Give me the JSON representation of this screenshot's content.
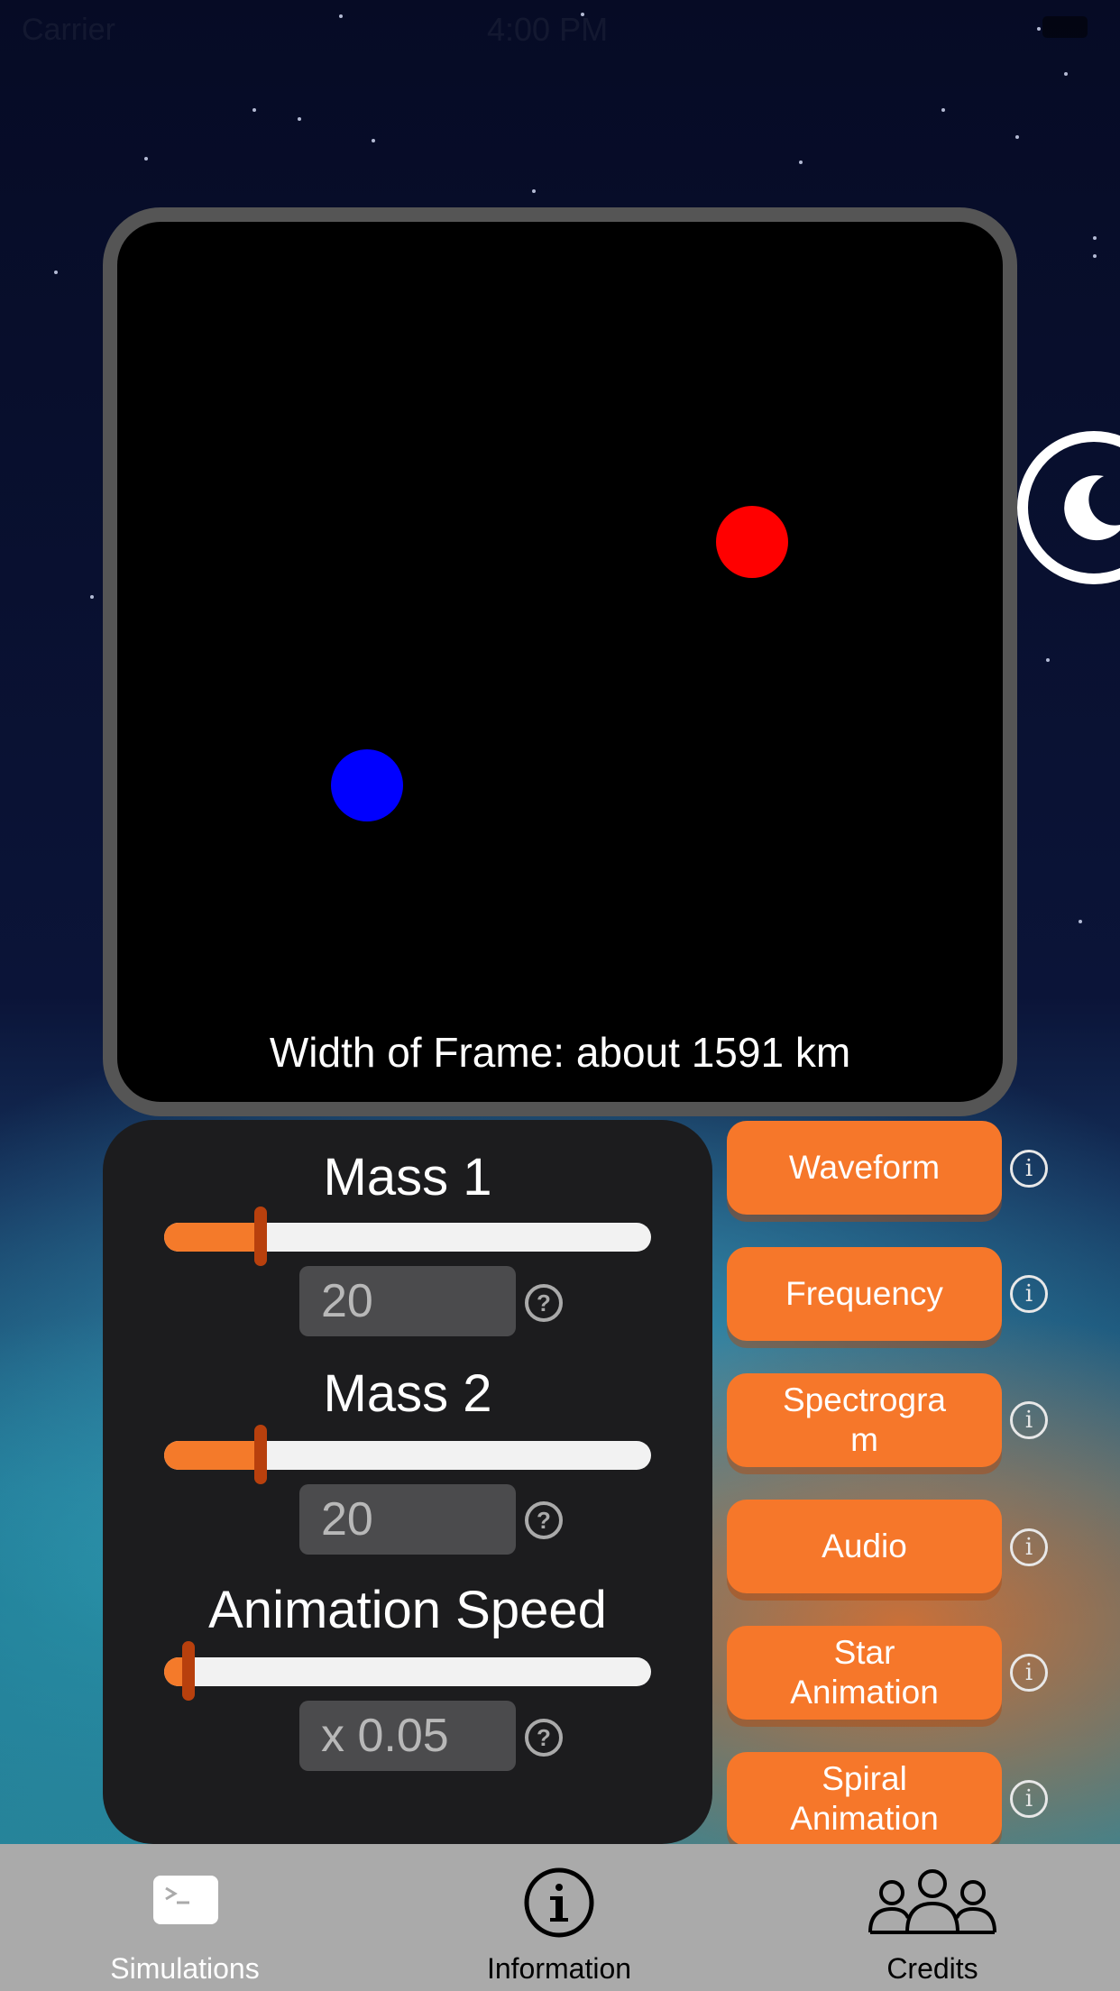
{
  "status_bar": {
    "carrier": "Carrier",
    "time": "4:00 PM"
  },
  "simulation": {
    "frame_caption": "Width of Frame: about 1591 km",
    "body1_color": "#ff0000",
    "body2_color": "#0000ff"
  },
  "controls": {
    "mass1": {
      "label": "Mass 1",
      "value": "20",
      "slider_fraction": 0.2
    },
    "mass2": {
      "label": "Mass 2",
      "value": "20",
      "slider_fraction": 0.2
    },
    "speed": {
      "label": "Animation Speed",
      "value": "x 0.05",
      "slider_fraction": 0.05
    },
    "help_glyph": "?"
  },
  "actions": [
    {
      "label": "Waveform"
    },
    {
      "label": "Frequency"
    },
    {
      "label": "Spectrogra\nm"
    },
    {
      "label": "Audio"
    },
    {
      "label": "Star\nAnimation"
    },
    {
      "label": "Spiral\nAnimation"
    }
  ],
  "info_glyph": "i",
  "tabbar": {
    "tabs": [
      {
        "label": "Simulations",
        "icon": "terminal-icon",
        "selected": true
      },
      {
        "label": "Information",
        "icon": "info-circle-icon",
        "selected": false
      },
      {
        "label": "Credits",
        "icon": "people-icon",
        "selected": false
      }
    ]
  },
  "colors": {
    "accent_orange": "#f6772a",
    "slider_thumb": "#b8400d",
    "panel": "#1c1c1e",
    "tabbar": "#aaaaaa"
  }
}
